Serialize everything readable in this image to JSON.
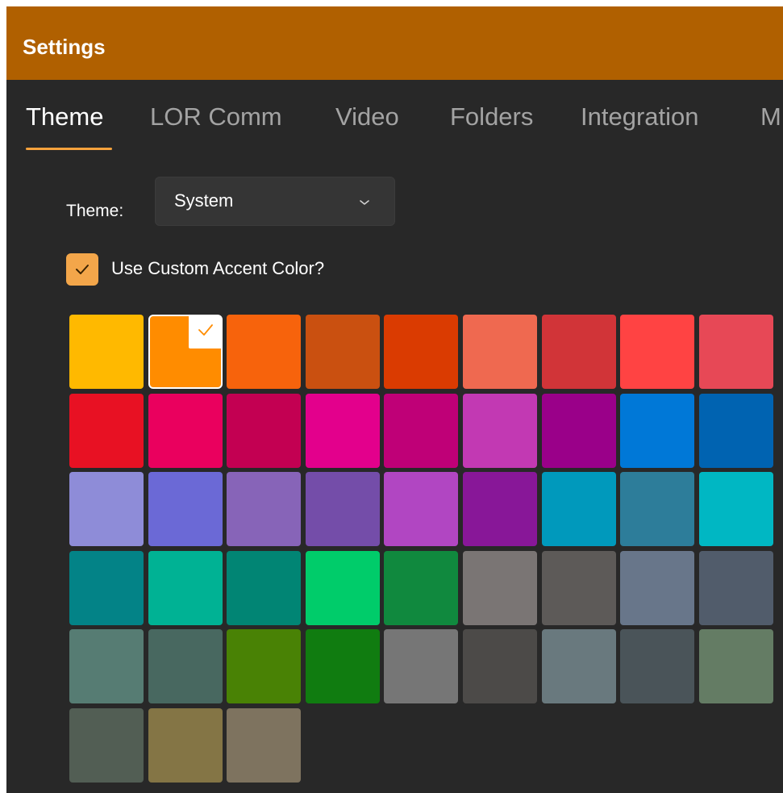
{
  "window": {
    "title": "Settings"
  },
  "tabs": [
    {
      "label": "Theme",
      "active": true
    },
    {
      "label": "LOR Comm",
      "active": false
    },
    {
      "label": "Video",
      "active": false
    },
    {
      "label": "Folders",
      "active": false
    },
    {
      "label": "Integration",
      "active": false
    },
    {
      "label": "M",
      "active": false
    }
  ],
  "theme": {
    "label": "Theme:",
    "selected": "System",
    "icon": "chevron-down-icon"
  },
  "accent": {
    "checkbox_checked": true,
    "label": "Use Custom Accent Color?"
  },
  "colors": {
    "titlebar": "#b06000",
    "accent": "#f3a64a",
    "background": "#282828"
  },
  "swatches": {
    "selected_index": 1,
    "colors": [
      "#ffb900",
      "#ff8c00",
      "#f7630c",
      "#ca5010",
      "#da3b01",
      "#ef6950",
      "#d13438",
      "#ff4343",
      "#e74856",
      "#e81123",
      "#ea005e",
      "#c30052",
      "#e3008c",
      "#bf0077",
      "#c239b3",
      "#9a0089",
      "#0078d7",
      "#0063b1",
      "#8e8cd8",
      "#6b69d6",
      "#8764b8",
      "#744da9",
      "#b146c2",
      "#881798",
      "#0099bc",
      "#2d7d9a",
      "#00b7c3",
      "#038387",
      "#00b294",
      "#018574",
      "#00cc6a",
      "#10893e",
      "#7a7574",
      "#5d5a58",
      "#68768a",
      "#515c6b",
      "#567c73",
      "#486860",
      "#498205",
      "#107c10",
      "#767676",
      "#4c4a48",
      "#69797e",
      "#4a5459",
      "#647c64",
      "#525e54",
      "#847545",
      "#7e735f"
    ]
  }
}
